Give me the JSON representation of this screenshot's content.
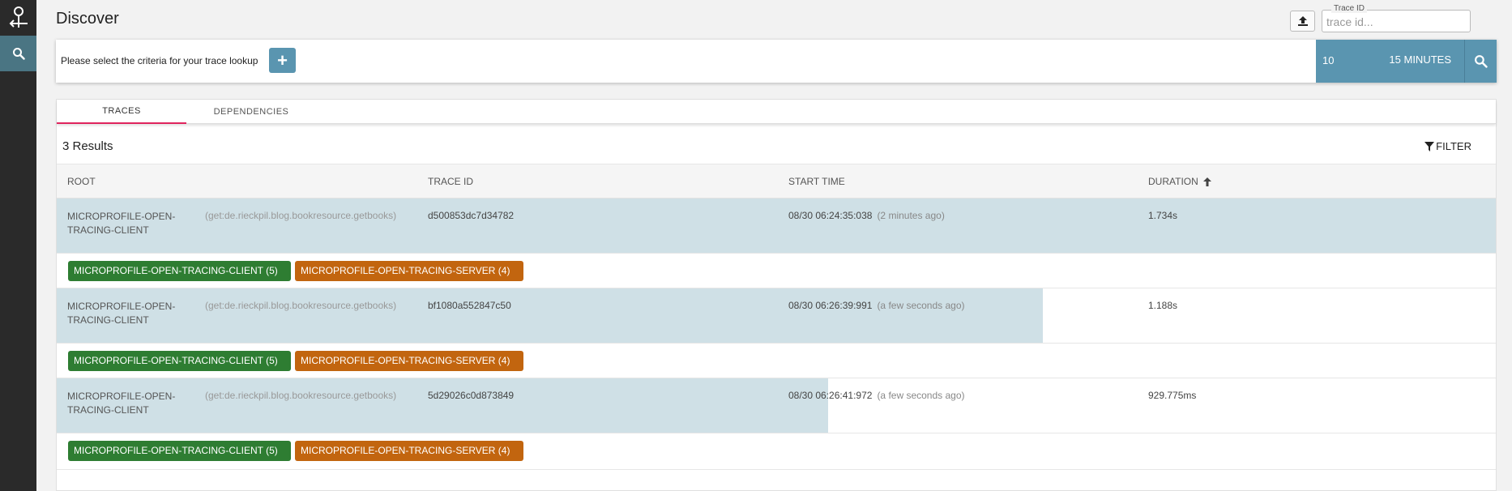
{
  "header": {
    "title": "Discover",
    "trace_id_label": "Trace ID",
    "trace_id_placeholder": "trace id..."
  },
  "search": {
    "criteria_text": "Please select the criteria for your trace lookup",
    "add_label": "+",
    "limit": "10",
    "lookback": "15 MINUTES"
  },
  "tabs": [
    {
      "label": "TRACES",
      "active": true
    },
    {
      "label": "DEPENDENCIES",
      "active": false
    }
  ],
  "results": {
    "count_label": "3 Results",
    "filter_label": "FILTER",
    "columns": [
      "ROOT",
      "TRACE ID",
      "START TIME",
      "DURATION"
    ],
    "rows": [
      {
        "root": "MICROPROFILE-OPEN-TRACING-CLIENT",
        "span": "(get:de.rieckpil.blog.bookresource.getbooks)",
        "trace_id": "d500853dc7d34782",
        "start_time": "08/30 06:24:35:038",
        "relative_time": "(2 minutes ago)",
        "duration": "1.734s",
        "duration_fraction": 1.0,
        "tags": [
          {
            "label": "MICROPROFILE-OPEN-TRACING-CLIENT (5)",
            "color": "#2e7d32"
          },
          {
            "label": "MICROPROFILE-OPEN-TRACING-SERVER (4)",
            "color": "#c2650f"
          }
        ]
      },
      {
        "root": "MICROPROFILE-OPEN-TRACING-CLIENT",
        "span": "(get:de.rieckpil.blog.bookresource.getbooks)",
        "trace_id": "bf1080a552847c50",
        "start_time": "08/30 06:26:39:991",
        "relative_time": "(a few seconds ago)",
        "duration": "1.188s",
        "duration_fraction": 0.685,
        "tags": [
          {
            "label": "MICROPROFILE-OPEN-TRACING-CLIENT (5)",
            "color": "#2e7d32"
          },
          {
            "label": "MICROPROFILE-OPEN-TRACING-SERVER (4)",
            "color": "#c2650f"
          }
        ]
      },
      {
        "root": "MICROPROFILE-OPEN-TRACING-CLIENT",
        "span": "(get:de.rieckpil.blog.bookresource.getbooks)",
        "trace_id": "5d29026c0d873849",
        "start_time": "08/30 06:26:41:972",
        "relative_time": "(a few seconds ago)",
        "duration": "929.775ms",
        "duration_fraction": 0.536,
        "tags": [
          {
            "label": "MICROPROFILE-OPEN-TRACING-CLIENT (5)",
            "color": "#2e7d32"
          },
          {
            "label": "MICROPROFILE-OPEN-TRACING-SERVER (4)",
            "color": "#c2650f"
          }
        ]
      }
    ]
  },
  "icons": {
    "logo": "zipkin-logo-icon",
    "nav": "search-icon",
    "upload": "upload-icon",
    "search": "search-icon",
    "filter": "filter-icon",
    "sort": "arrow-up-icon"
  },
  "colors": {
    "accent": "#5a95b0",
    "tab_indicator": "#e0245e",
    "duration_bar": "#cfe0e6",
    "sidebar": "#2a2a2a"
  }
}
